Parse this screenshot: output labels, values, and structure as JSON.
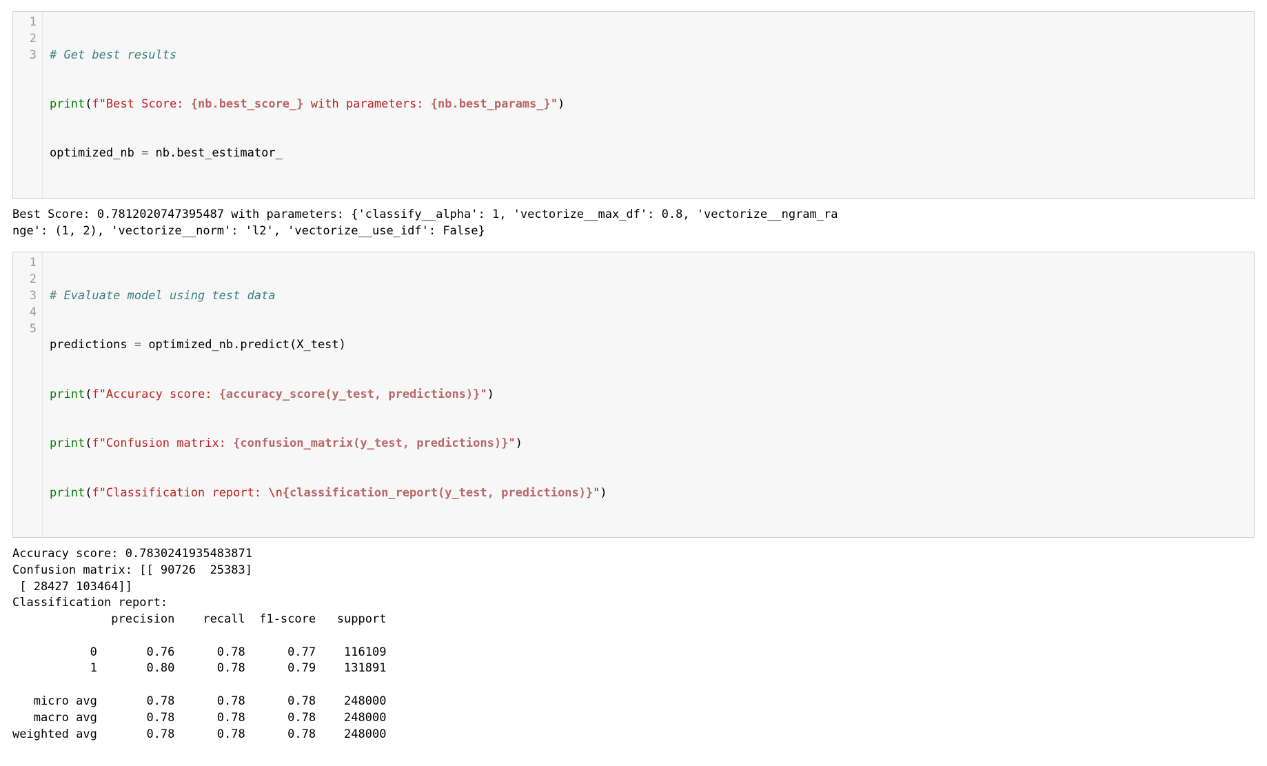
{
  "cell1": {
    "lineNumbers": [
      "1",
      "2",
      "3"
    ],
    "code": {
      "l1_comment": "# Get best results",
      "l2_print": "print",
      "l2_f": "f",
      "l2_s1": "\"Best Score: ",
      "l2_i1": "{nb.best_score_}",
      "l2_s2": " with parameters: ",
      "l2_i2": "{nb.best_params_}",
      "l2_s3": "\"",
      "l3_lhs": "optimized_nb ",
      "l3_eq": "=",
      "l3_rhs": " nb.best_estimator_"
    }
  },
  "output1": "Best Score: 0.7812020747395487 with parameters: {'classify__alpha': 1, 'vectorize__max_df': 0.8, 'vectorize__ngram_ra\nnge': (1, 2), 'vectorize__norm': 'l2', 'vectorize__use_idf': False}",
  "cell2": {
    "lineNumbers": [
      "1",
      "2",
      "3",
      "4",
      "5"
    ],
    "code": {
      "l1_comment": "# Evaluate model using test data",
      "l2_lhs": "predictions ",
      "l2_eq": "=",
      "l2_rhs": " optimized_nb.predict(X_test)",
      "l3_print": "print",
      "l3_f": "f",
      "l3_s1": "\"Accuracy score: ",
      "l3_i1": "{accuracy_score(y_test, predictions)}",
      "l3_s2": "\"",
      "l4_print": "print",
      "l4_f": "f",
      "l4_s1": "\"Confusion matrix: ",
      "l4_i1": "{confusion_matrix(y_test, predictions)}",
      "l4_s2": "\"",
      "l5_print": "print",
      "l5_f": "f",
      "l5_s1": "\"Classification report: ",
      "l5_esc": "\\n",
      "l5_i1": "{classification_report(y_test, predictions)}",
      "l5_s2": "\""
    }
  },
  "output2": "Accuracy score: 0.7830241935483871\nConfusion matrix: [[ 90726  25383]\n [ 28427 103464]]\nClassification report: \n              precision    recall  f1-score   support\n\n           0       0.76      0.78      0.77    116109\n           1       0.80      0.78      0.79    131891\n\n   micro avg       0.78      0.78      0.78    248000\n   macro avg       0.78      0.78      0.78    248000\nweighted avg       0.78      0.78      0.78    248000\n"
}
